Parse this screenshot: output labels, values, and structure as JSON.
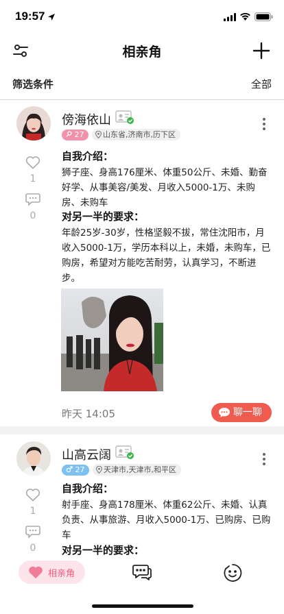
{
  "status_bar": {
    "time": "19:57"
  },
  "nav": {
    "title": "相亲角"
  },
  "filter": {
    "label": "筛选条件",
    "value": "全部"
  },
  "posts": [
    {
      "name": "傍海依山",
      "gender": "female",
      "age": "27",
      "location": "山东省,济南市,历下区",
      "likes": "1",
      "comments": "0",
      "intro_heading": "自我介绍：",
      "intro_text": "狮子座、身高176厘米、体重50公斤、未婚、勤奋好学、从事美容/美发、月收入5000-1万、未购房、未购车",
      "req_heading": "对另一半的要求：",
      "req_text": "年龄25岁-30岁，性格坚毅不拔，常住沈阳市，月收入5000-1万，学历本科以上，未婚，未购车，已购房，希望对方能吃苦耐劳，认真学习，不断进步。",
      "time": "昨天 14:05",
      "chat_label": "聊一聊"
    },
    {
      "name": "山高云阔",
      "gender": "male",
      "age": "27",
      "location": "天津市,天津市,和平区",
      "likes": "1",
      "comments": "0",
      "intro_heading": "自我介绍：",
      "intro_text": "射手座、身高178厘米、体重62公斤、未婚、认真负责、从事旅游、月收入5000-1万、已购房、已购车",
      "req_heading": "对另一半的要求："
    }
  ],
  "tabbar": {
    "home_label": "相亲角"
  },
  "colors": {
    "accent_red": "#f05b4f",
    "female_pink": "#f291aa",
    "male_blue": "#7cc1f2",
    "tab_active_bg": "#fde3ea"
  },
  "icons": [
    "location-arrow-icon",
    "signal-icon",
    "wifi-icon",
    "battery-icon",
    "filter-sliders-icon",
    "plus-icon",
    "id-verified-icon",
    "female-icon",
    "male-icon",
    "location-pin-icon",
    "more-vertical-icon",
    "heart-icon",
    "comment-icon",
    "chat-bubble-icon",
    "messages-icon",
    "smiley-icon"
  ]
}
